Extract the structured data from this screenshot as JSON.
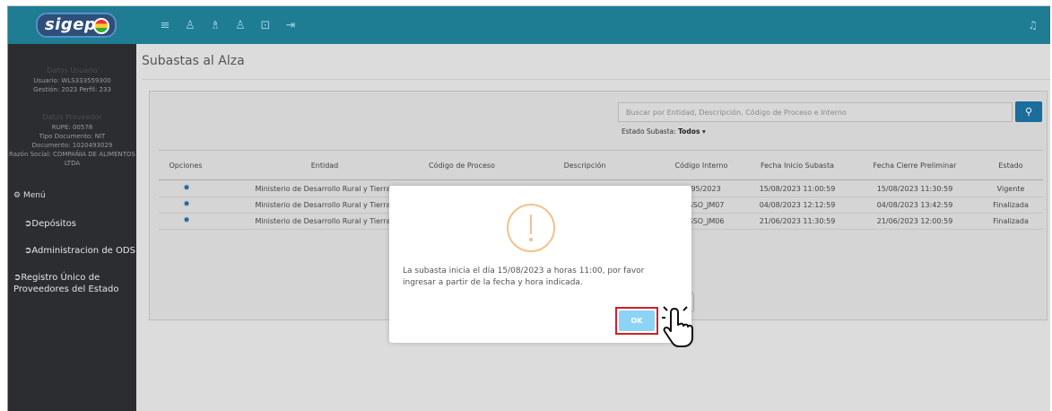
{
  "brand": {
    "logo_text": "sigep"
  },
  "topbar": {
    "icons": [
      "menu-icon",
      "user-icon",
      "users-icon",
      "user-check-icon",
      "lock-icon",
      "logout-icon"
    ],
    "glyphs": [
      "≡",
      "♙",
      "♗",
      "♙",
      "⊡",
      "⇥"
    ],
    "bell_glyph": "♫"
  },
  "sidebar": {
    "user_heading": "Datos Usuario",
    "user_line1": "Usuario: WLS333559300",
    "user_line2": "Gestión: 2023 Perfil: 233",
    "provider_heading": "Datos Proveedor",
    "provider_line1": "RUPE: 00578",
    "provider_line2": "Tipo Documento: NIT",
    "provider_line3": "Documento: 1020493029",
    "provider_line4": "Razón Social: COMPAÑIA DE ALIMENTOS",
    "provider_line5": "LTDA",
    "menu_title": "Menú",
    "items": [
      {
        "label": "Depósitos"
      },
      {
        "label": "Administracion de ODS"
      },
      {
        "label": "Registro Único de"
      },
      {
        "label": "Proveedores del Estado"
      }
    ]
  },
  "page": {
    "title": "Subastas al Alza"
  },
  "search": {
    "placeholder": "Buscar por Entidad, Descripción, Código de Proceso e Interno",
    "button_glyph": "⚲",
    "estado_label": "Estado Subasta:",
    "estado_value": "Todos ▾"
  },
  "table": {
    "headers": [
      "Opciones",
      "Entidad",
      "Código de Proceso",
      "Descripción",
      "Código Interno",
      "Fecha Inicio Subasta",
      "Fecha Cierre Preliminar",
      "Estado"
    ],
    "rows": [
      {
        "entidad": "Ministerio de Desarrollo Rural y Tierras",
        "codigo_interno": "4895/2023",
        "inicio": "15/08/2023 11:00:59",
        "cierre": "15/08/2023 11:30:59",
        "estado": "Vigente"
      },
      {
        "entidad": "Ministerio de Desarrollo Rural y Tierras",
        "codigo_interno": "CASSO_JM07",
        "inicio": "04/08/2023 12:12:59",
        "cierre": "04/08/2023 13:42:59",
        "estado": "Finalizada"
      },
      {
        "entidad": "Ministerio de Desarrollo Rural y Tierras",
        "codigo_interno": "CASSO_JM06",
        "inicio": "21/06/2023 11:30:59",
        "cierre": "21/06/2023 12:00:59",
        "estado": "Finalizada"
      }
    ]
  },
  "modal": {
    "message": "La subasta inicia el día 15/08/2023 a horas 11:00, por favor ingresar a partir de la fecha y hora indicada.",
    "ok_label": "OK"
  },
  "colors": {
    "topbar": "#1e7c93",
    "sidebar": "#2b2d31",
    "accent": "#1b6d9c",
    "ok_button": "#8cd4f5",
    "warning": "#f5c08a",
    "highlight": "#d0202a"
  }
}
